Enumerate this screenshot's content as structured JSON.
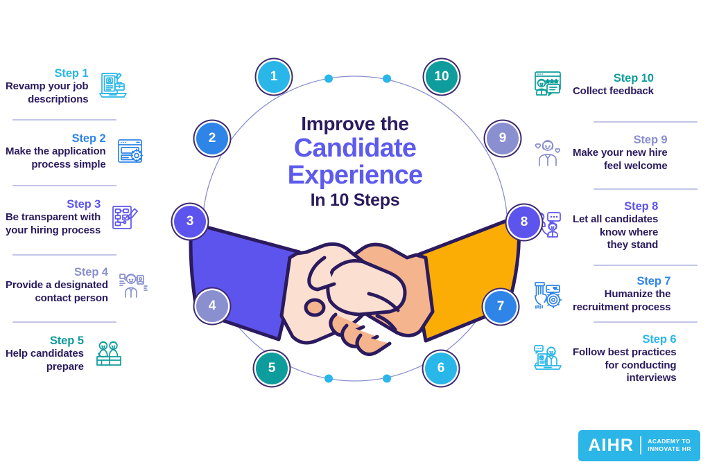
{
  "title": {
    "line1": "Improve the",
    "line2": "Candidate",
    "line3": "Experience",
    "line4": "In 10 Steps"
  },
  "colors": {
    "cyan": "#29b6e8",
    "blue": "#2f84e8",
    "indigo": "#5d54ed",
    "periwinkle": "#8a8fd0",
    "teal": "#0e9c9c",
    "dark": "#2b1b5e",
    "ring": "#8a8fd0",
    "orange": "#fbad06",
    "skin_light": "#fbe0d2",
    "skin_dark": "#f4b48e",
    "sleeve_blue": "#5d54ed"
  },
  "left_steps": [
    {
      "label": "Step 1",
      "desc": "Revamp your job\ndescriptions",
      "color": "#29b6e8",
      "icon": "laptop-resume-briefcase-icon"
    },
    {
      "label": "Step 2",
      "desc": "Make the application\nprocess simple",
      "color": "#2f84e8",
      "icon": "browser-gear-icon"
    },
    {
      "label": "Step 3",
      "desc": "Be transparent with\nyour hiring process",
      "color": "#5d54ed",
      "icon": "flowchart-pencil-icon"
    },
    {
      "label": "Step 4",
      "desc": "Provide a designated\ncontact person",
      "color": "#8a8fd0",
      "icon": "support-agent-icon"
    },
    {
      "label": "Step 5",
      "desc": "Help candidates\nprepare",
      "color": "#0e9c9c",
      "icon": "two-people-desk-icon"
    }
  ],
  "right_steps": [
    {
      "label": "Step 10",
      "desc": "Collect feedback",
      "color": "#0e9c9c",
      "icon": "review-stars-icon"
    },
    {
      "label": "Step 9",
      "desc": "Make your new hire\nfeel welcome",
      "color": "#8a8fd0",
      "icon": "person-hearts-icon"
    },
    {
      "label": "Step 8",
      "desc": "Let all candidates\nknow where\nthey stand",
      "color": "#5d54ed",
      "icon": "two-people-chat-icon"
    },
    {
      "label": "Step 7",
      "desc": "Humanize the\nrecruitment process",
      "color": "#2f84e8",
      "icon": "hand-gear-heart-icon"
    },
    {
      "label": "Step 6",
      "desc": "Follow best practices\nfor conducting\ninterviews",
      "color": "#29b6e8",
      "icon": "interview-desk-icon"
    }
  ],
  "circles": [
    {
      "number": "1",
      "color": "#29b6e8"
    },
    {
      "number": "2",
      "color": "#2f84e8"
    },
    {
      "number": "3",
      "color": "#5d54ed"
    },
    {
      "number": "4",
      "color": "#8a8fd0"
    },
    {
      "number": "5",
      "color": "#0e9c9c"
    },
    {
      "number": "6",
      "color": "#29b6e8"
    },
    {
      "number": "7",
      "color": "#2f84e8"
    },
    {
      "number": "8",
      "color": "#5d54ed"
    },
    {
      "number": "9",
      "color": "#8a8fd0"
    },
    {
      "number": "10",
      "color": "#0e9c9c"
    }
  ],
  "logo": {
    "main": "AIHR",
    "sub": "ACADEMY TO\nINNOVATE HR",
    "bg": "#2cb6e8"
  }
}
